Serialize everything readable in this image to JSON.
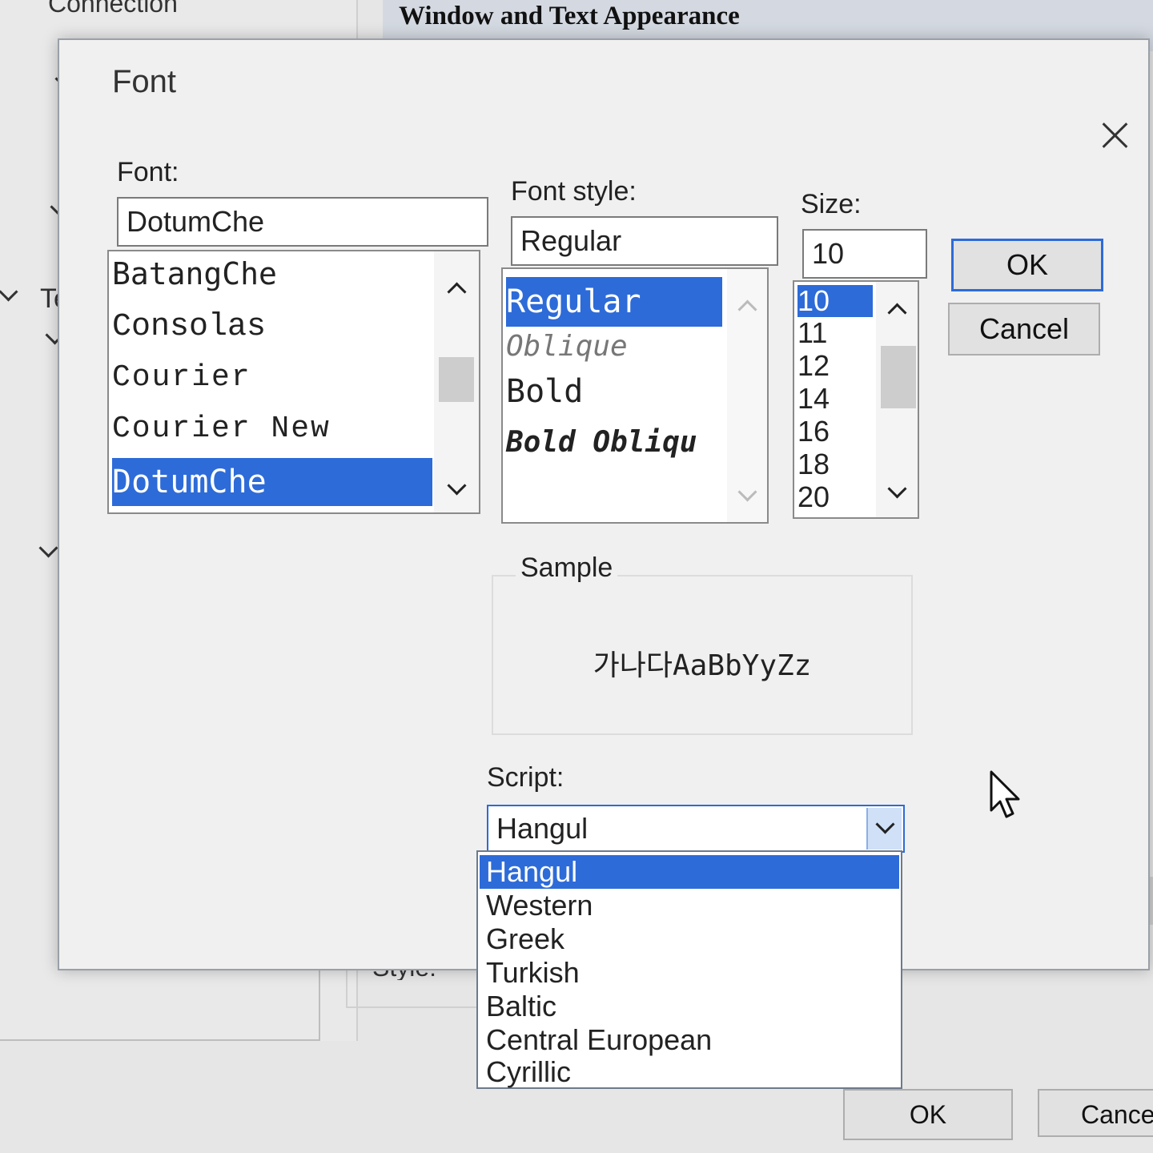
{
  "background": {
    "window_title": "Window and Text Appearance",
    "connection_label": "Connection",
    "terminal_fragment": "Ter",
    "style_fragment": "Style:",
    "ok_label": "OK",
    "cancel_label": "Cance"
  },
  "dialog": {
    "title": "Font",
    "font": {
      "label": "Font:",
      "value": "DotumChe",
      "items": [
        "BatangChe",
        "Consolas",
        "Courier",
        "Courier New",
        "DotumChe"
      ],
      "selected": "DotumChe"
    },
    "font_style": {
      "label": "Font style:",
      "value": "Regular",
      "items": [
        "Regular",
        "Oblique",
        "Bold",
        "Bold Obliqu"
      ],
      "selected": "Regular"
    },
    "size": {
      "label": "Size:",
      "value": "10",
      "items": [
        "10",
        "11",
        "12",
        "14",
        "16",
        "18",
        "20"
      ],
      "selected": "10"
    },
    "ok_label": "OK",
    "cancel_label": "Cancel",
    "sample": {
      "label": "Sample",
      "text": "가나다AaBbYyZz"
    },
    "script": {
      "label": "Script:",
      "value": "Hangul",
      "options": [
        "Hangul",
        "Western",
        "Greek",
        "Turkish",
        "Baltic",
        "Central European",
        "Cyrillic"
      ],
      "selected": "Hangul"
    }
  },
  "colors": {
    "selection": "#2d6bd8",
    "dialog_bg": "#f0f0f0"
  }
}
